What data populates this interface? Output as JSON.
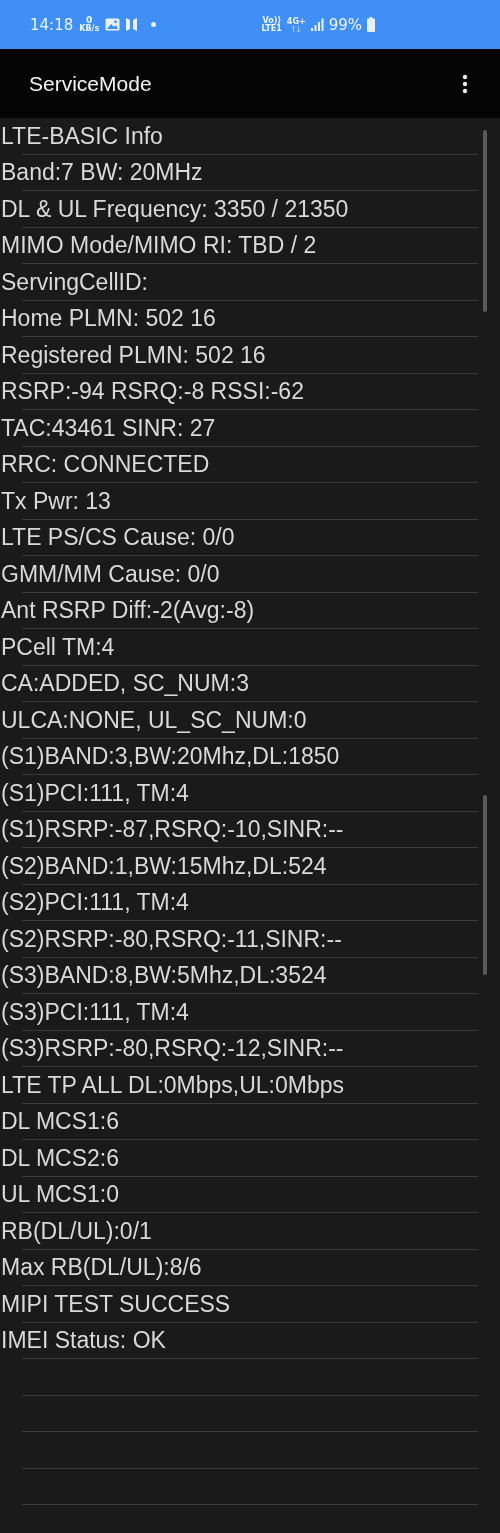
{
  "status_bar": {
    "time": "14:18",
    "net_speed_value": "0",
    "net_speed_unit": "KB/s",
    "volte": "Vo))",
    "lte": "LTE1",
    "network": "4G+",
    "battery": "99%"
  },
  "app_bar": {
    "title": "ServiceMode"
  },
  "rows": [
    "LTE-BASIC Info",
    "Band:7 BW: 20MHz",
    "DL & UL Frequency: 3350 / 21350",
    "MIMO Mode/MIMO RI: TBD / 2",
    "ServingCellID:",
    "Home PLMN: 502 16",
    "Registered PLMN: 502 16",
    "RSRP:-94 RSRQ:-8 RSSI:-62",
    "TAC:43461 SINR: 27",
    "RRC: CONNECTED",
    "Tx Pwr: 13",
    "LTE PS/CS Cause: 0/0",
    "GMM/MM Cause: 0/0",
    "Ant RSRP Diff:-2(Avg:-8)",
    "PCell TM:4",
    "CA:ADDED, SC_NUM:3",
    "ULCA:NONE, UL_SC_NUM:0",
    "(S1)BAND:3,BW:20Mhz,DL:1850",
    "(S1)PCI:111, TM:4",
    "(S1)RSRP:-87,RSRQ:-10,SINR:--",
    "(S2)BAND:1,BW:15Mhz,DL:524",
    "(S2)PCI:111, TM:4",
    "(S2)RSRP:-80,RSRQ:-11,SINR:--",
    "(S3)BAND:8,BW:5Mhz,DL:3524",
    "(S3)PCI:111, TM:4",
    "(S3)RSRP:-80,RSRQ:-12,SINR:--",
    "LTE TP ALL DL:0Mbps,UL:0Mbps",
    "DL MCS1:6",
    "DL MCS2:6",
    "UL MCS1:0",
    "RB(DL/UL):0/1",
    "Max RB(DL/UL):8/6",
    "MIPI TEST SUCCESS",
    "IMEI Status: OK"
  ]
}
